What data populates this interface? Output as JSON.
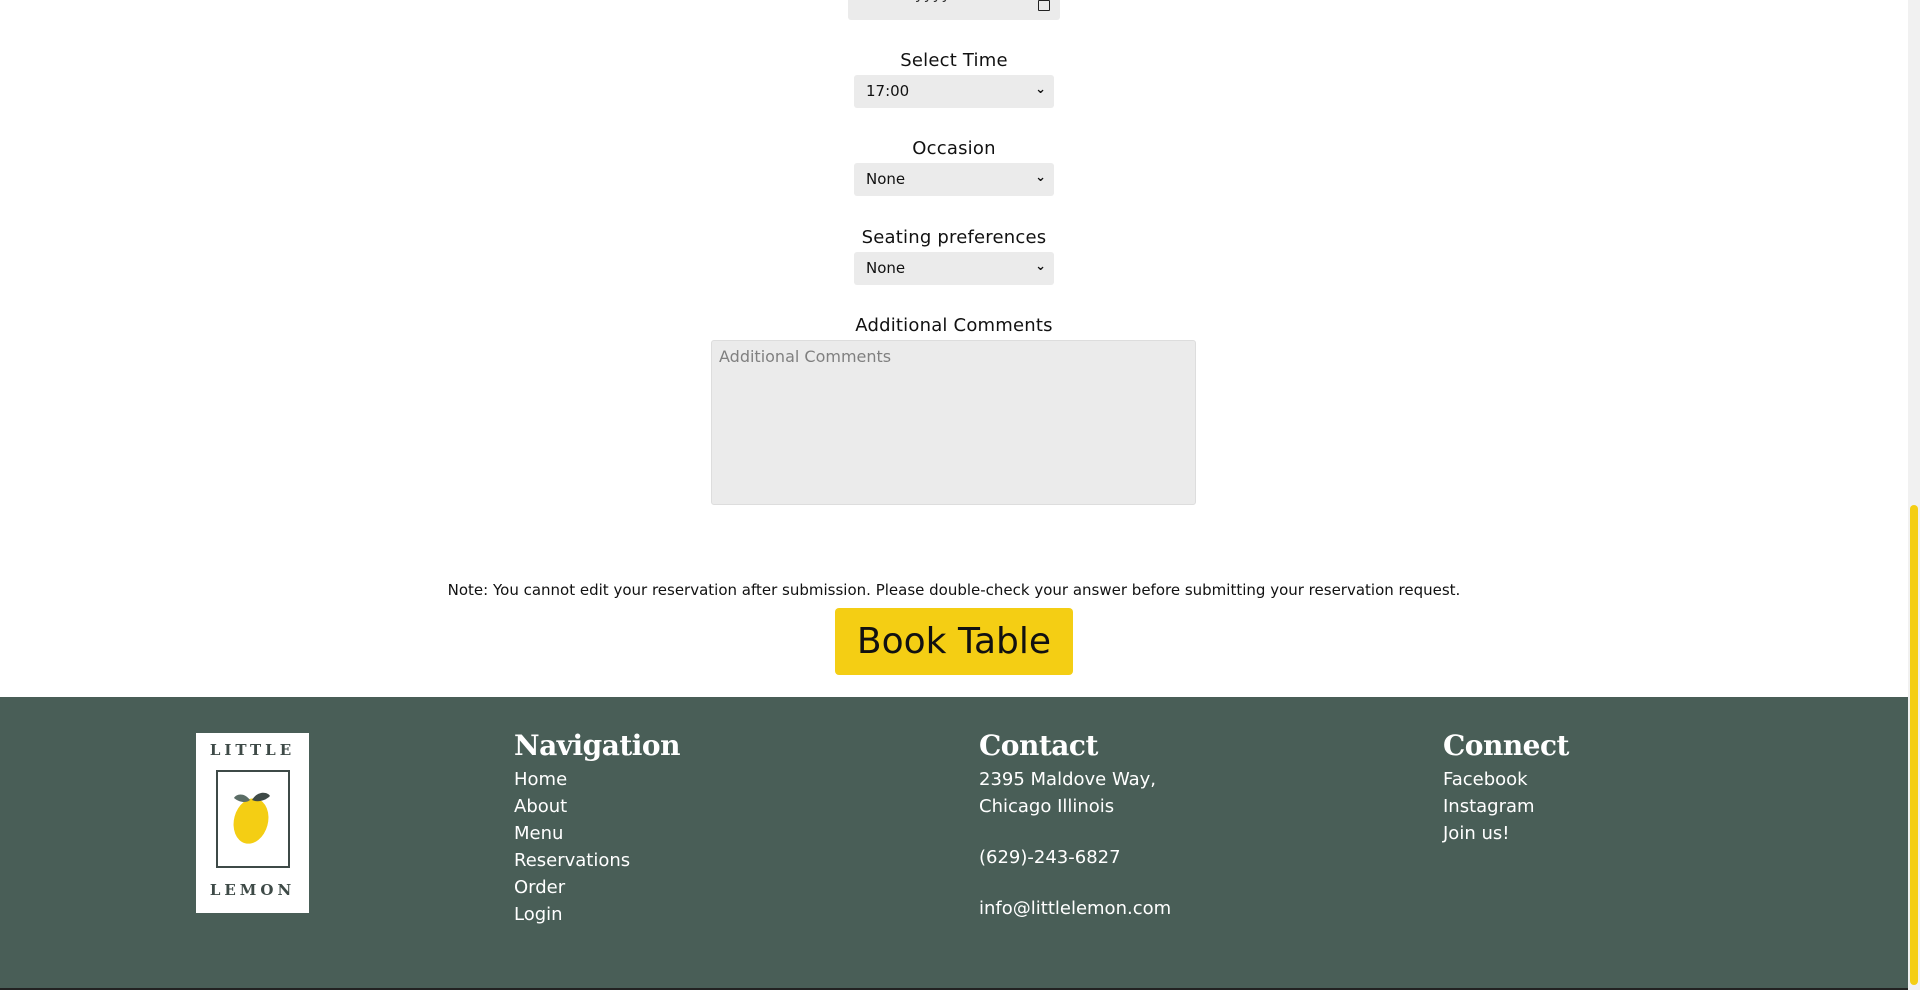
{
  "form": {
    "date_placeholder": "dd-mm-yyyy",
    "time_label": "Select Time",
    "time_value": "17:00",
    "occasion_label": "Occasion",
    "occasion_value": "None",
    "seating_label": "Seating preferences",
    "seating_value": "None",
    "comments_label": "Additional Comments",
    "comments_placeholder": "Additional Comments",
    "note": "Note: You cannot edit your reservation after submission. Please double-check your answer before submitting your reservation request.",
    "submit_label": "Book Table"
  },
  "footer": {
    "logo_top": "LITTLE",
    "logo_bottom": "LEMON",
    "navigation": {
      "heading": "Navigation",
      "items": [
        "Home",
        "About",
        "Menu",
        "Reservations",
        "Order",
        "Login"
      ]
    },
    "contact": {
      "heading": "Contact",
      "address_line1": "2395 Maldove Way,",
      "address_line2": "Chicago Illinois",
      "phone": "(629)-243-6827",
      "email": "info@littlelemon.com"
    },
    "connect": {
      "heading": "Connect",
      "items": [
        "Facebook",
        "Instagram",
        "Join us!"
      ]
    }
  },
  "colors": {
    "accent_yellow": "#f4ce14",
    "footer_green": "#495e57",
    "input_gray": "#ebebeb"
  },
  "icons": {
    "calendar": "calendar-icon",
    "chevron": "chevron-down-icon",
    "logo": "lemon-logo"
  }
}
